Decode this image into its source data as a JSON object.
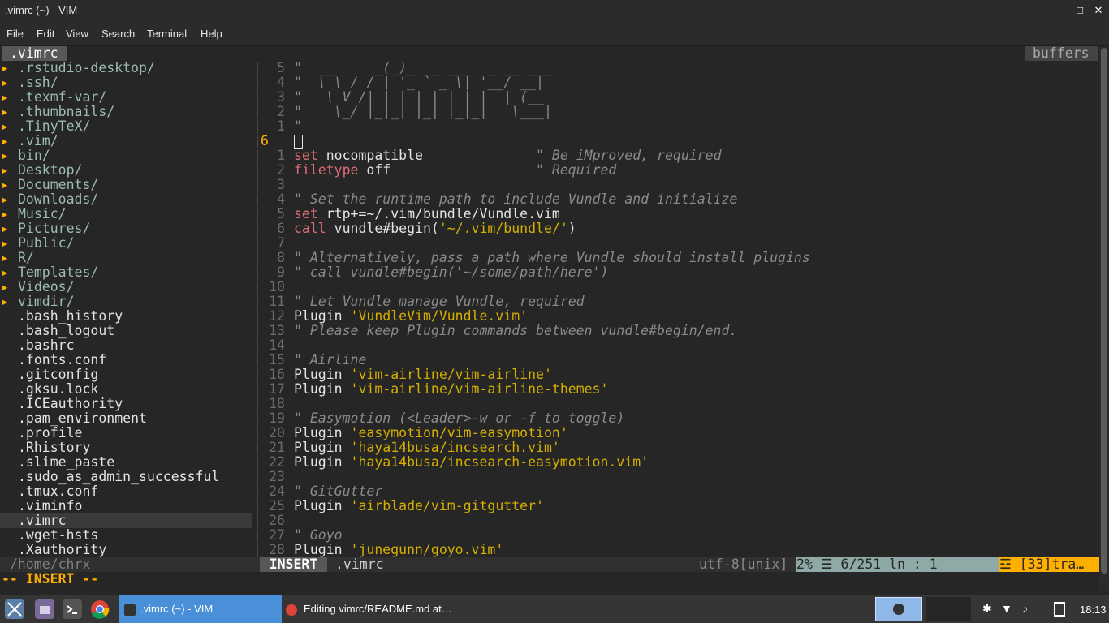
{
  "window": {
    "title": ".vimrc (~) - VIM",
    "minimize": "–",
    "maximize": "□",
    "close": "✕"
  },
  "menu": [
    "File",
    "Edit",
    "View",
    "Search",
    "Terminal",
    "Help"
  ],
  "tabs": {
    "left": ".vimrc",
    "right": "buffers"
  },
  "tree": [
    {
      "name": ".rstudio-desktop/",
      "dir": true
    },
    {
      "name": ".ssh/",
      "dir": true
    },
    {
      "name": ".texmf-var/",
      "dir": true
    },
    {
      "name": ".thumbnails/",
      "dir": true
    },
    {
      "name": ".TinyTeX/",
      "dir": true
    },
    {
      "name": ".vim/",
      "dir": true
    },
    {
      "name": "bin/",
      "dir": true
    },
    {
      "name": "Desktop/",
      "dir": true
    },
    {
      "name": "Documents/",
      "dir": true
    },
    {
      "name": "Downloads/",
      "dir": true
    },
    {
      "name": "Music/",
      "dir": true
    },
    {
      "name": "Pictures/",
      "dir": true
    },
    {
      "name": "Public/",
      "dir": true
    },
    {
      "name": "R/",
      "dir": true
    },
    {
      "name": "Templates/",
      "dir": true
    },
    {
      "name": "Videos/",
      "dir": true
    },
    {
      "name": "vimdir/",
      "dir": true
    },
    {
      "name": ".bash_history",
      "dir": false
    },
    {
      "name": ".bash_logout",
      "dir": false
    },
    {
      "name": ".bashrc",
      "dir": false
    },
    {
      "name": ".fonts.conf",
      "dir": false
    },
    {
      "name": ".gitconfig",
      "dir": false
    },
    {
      "name": ".gksu.lock",
      "dir": false
    },
    {
      "name": ".ICEauthority",
      "dir": false
    },
    {
      "name": ".pam_environment",
      "dir": false
    },
    {
      "name": ".profile",
      "dir": false
    },
    {
      "name": ".Rhistory",
      "dir": false
    },
    {
      "name": ".slime_paste",
      "dir": false
    },
    {
      "name": ".sudo_as_admin_successful",
      "dir": false
    },
    {
      "name": ".tmux.conf",
      "dir": false
    },
    {
      "name": ".viminfo",
      "dir": false
    },
    {
      "name": ".vimrc",
      "dir": false,
      "selected": true
    },
    {
      "name": ".wget-hsts",
      "dir": false
    },
    {
      "name": ".Xauthority",
      "dir": false
    }
  ],
  "tree_arrow": "▶",
  "separator": "|",
  "editor_lines": [
    {
      "num": "5",
      "segs": [
        {
          "t": "\"  __     _(_)_ __ ___  _ __ ___",
          "c": "com"
        }
      ]
    },
    {
      "num": "4",
      "segs": [
        {
          "t": "\"  \\ \\ / / | '_ ` _ \\| '__/ __|",
          "c": "com"
        }
      ]
    },
    {
      "num": "3",
      "segs": [
        {
          "t": "\"   \\ V /| | | | | | | |  | (__",
          "c": "com"
        }
      ]
    },
    {
      "num": "2",
      "segs": [
        {
          "t": "\"    \\_/ |_|_| |_| |_|_|   \\___|",
          "c": "com"
        }
      ]
    },
    {
      "num": "1",
      "segs": [
        {
          "t": "\"",
          "c": "com"
        }
      ]
    },
    {
      "num": "6",
      "current": true,
      "cursor": true,
      "segs": []
    },
    {
      "num": "1",
      "segs": [
        {
          "t": "set",
          "c": "kw"
        },
        {
          "t": " nocompatible              ",
          "c": ""
        },
        {
          "t": "\" Be iMproved, required",
          "c": "com"
        }
      ]
    },
    {
      "num": "2",
      "segs": [
        {
          "t": "filetype",
          "c": "kw"
        },
        {
          "t": " off                  ",
          "c": ""
        },
        {
          "t": "\" Required",
          "c": "com"
        }
      ]
    },
    {
      "num": "3",
      "segs": []
    },
    {
      "num": "4",
      "segs": [
        {
          "t": "\" Set the runtime path to include Vundle and initialize",
          "c": "com"
        }
      ]
    },
    {
      "num": "5",
      "segs": [
        {
          "t": "set",
          "c": "kw"
        },
        {
          "t": " rtp+=~/.vim/bundle/Vundle.vim",
          "c": ""
        }
      ]
    },
    {
      "num": "6",
      "segs": [
        {
          "t": "call",
          "c": "kw"
        },
        {
          "t": " vundle#begin(",
          "c": ""
        },
        {
          "t": "'~/.vim/bundle/'",
          "c": "str"
        },
        {
          "t": ")",
          "c": ""
        }
      ]
    },
    {
      "num": "7",
      "segs": []
    },
    {
      "num": "8",
      "segs": [
        {
          "t": "\" Alternatively, pass a path where Vundle should install plugins",
          "c": "com"
        }
      ]
    },
    {
      "num": "9",
      "segs": [
        {
          "t": "\" call vundle#begin('~/some/path/here')",
          "c": "com"
        }
      ]
    },
    {
      "num": "10",
      "segs": []
    },
    {
      "num": "11",
      "segs": [
        {
          "t": "\" Let Vundle manage Vundle, required",
          "c": "com"
        }
      ]
    },
    {
      "num": "12",
      "segs": [
        {
          "t": "Plugin ",
          "c": ""
        },
        {
          "t": "'VundleVim/Vundle.vim'",
          "c": "str"
        }
      ]
    },
    {
      "num": "13",
      "segs": [
        {
          "t": "\" Please keep Plugin commands between vundle#begin/end.",
          "c": "com"
        }
      ]
    },
    {
      "num": "14",
      "segs": []
    },
    {
      "num": "15",
      "segs": [
        {
          "t": "\" Airline",
          "c": "com"
        }
      ]
    },
    {
      "num": "16",
      "segs": [
        {
          "t": "Plugin ",
          "c": ""
        },
        {
          "t": "'vim-airline/vim-airline'",
          "c": "str"
        }
      ]
    },
    {
      "num": "17",
      "segs": [
        {
          "t": "Plugin ",
          "c": ""
        },
        {
          "t": "'vim-airline/vim-airline-themes'",
          "c": "str"
        }
      ]
    },
    {
      "num": "18",
      "segs": []
    },
    {
      "num": "19",
      "segs": [
        {
          "t": "\" Easymotion (<Leader>-w or -f to toggle)",
          "c": "com"
        }
      ]
    },
    {
      "num": "20",
      "segs": [
        {
          "t": "Plugin ",
          "c": ""
        },
        {
          "t": "'easymotion/vim-easymotion'",
          "c": "str"
        }
      ]
    },
    {
      "num": "21",
      "segs": [
        {
          "t": "Plugin ",
          "c": ""
        },
        {
          "t": "'haya14busa/incsearch.vim'",
          "c": "str"
        }
      ]
    },
    {
      "num": "22",
      "segs": [
        {
          "t": "Plugin ",
          "c": ""
        },
        {
          "t": "'haya14busa/incsearch-easymotion.vim'",
          "c": "str"
        }
      ]
    },
    {
      "num": "23",
      "segs": []
    },
    {
      "num": "24",
      "segs": [
        {
          "t": "\" GitGutter",
          "c": "com"
        }
      ]
    },
    {
      "num": "25",
      "segs": [
        {
          "t": "Plugin ",
          "c": ""
        },
        {
          "t": "'airblade/vim-gitgutter'",
          "c": "str"
        }
      ]
    },
    {
      "num": "26",
      "segs": []
    },
    {
      "num": "27",
      "segs": [
        {
          "t": "\" Goyo",
          "c": "com"
        }
      ]
    },
    {
      "num": "28",
      "segs": [
        {
          "t": "Plugin ",
          "c": ""
        },
        {
          "t": "'junegunn/goyo.vim'",
          "c": "str"
        }
      ]
    }
  ],
  "status": {
    "tree_path": "/home/chrx",
    "mode": "INSERT",
    "file": ".vimrc",
    "encoding": "utf-8[unix]",
    "position": " 2% ☰   6/251 ln :  1 ",
    "warning": "☲ [33]tra…"
  },
  "cmdline": "-- INSERT --",
  "taskbar": {
    "tasks": [
      {
        "label": ".vimrc (~) - VIM",
        "active": true
      },
      {
        "label": "Editing vimrc/README.md at…",
        "active": false
      }
    ],
    "clock": "18:13"
  },
  "colors": {
    "accent_orange": "#ffaf00",
    "string": "#d7af00",
    "keyword": "#e06c75",
    "comment": "#8a8a8a",
    "active_task": "#4a90d9"
  }
}
